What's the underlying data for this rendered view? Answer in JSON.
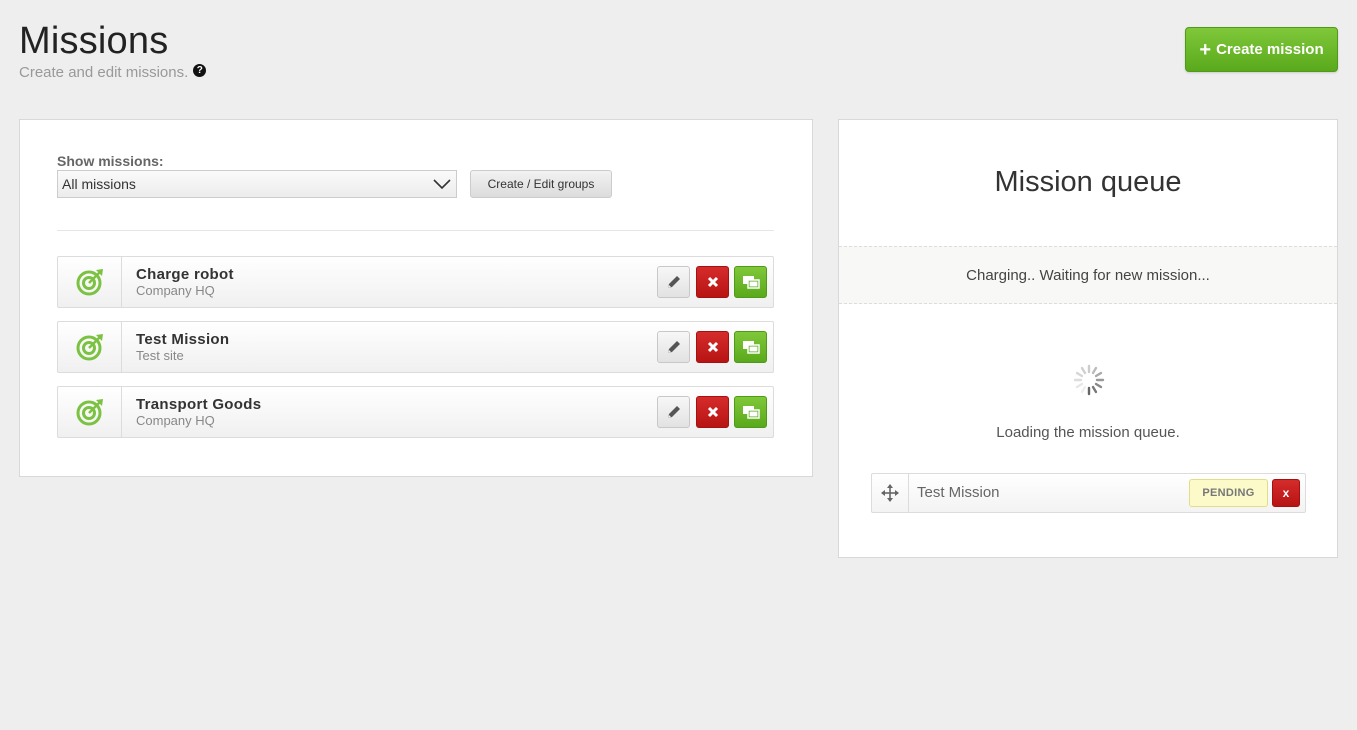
{
  "header": {
    "title": "Missions",
    "subtitle": "Create and edit missions.",
    "help_icon": "question-circle-icon",
    "create_button": {
      "icon": "plus-icon",
      "label": "Create mission"
    }
  },
  "colors": {
    "accent_green": "#6bb82a",
    "danger_red": "#c41f1f",
    "pending_yellow": "#fbfac8",
    "background": "#eeeeee"
  },
  "missions_panel": {
    "filter_label": "Show missions:",
    "filter_value": "All missions",
    "groups_button": "Create / Edit groups",
    "missions": [
      {
        "name": "Charge robot",
        "site": "Company HQ",
        "icon": "target-icon"
      },
      {
        "name": "Test Mission",
        "site": "Test site",
        "icon": "target-icon"
      },
      {
        "name": "Transport Goods",
        "site": "Company HQ",
        "icon": "target-icon"
      }
    ],
    "row_actions": [
      "pencil-icon",
      "close-icon",
      "duplicate-icon"
    ]
  },
  "queue_panel": {
    "title": "Mission queue",
    "status": "Charging.. Waiting for new mission...",
    "loading_text": "Loading the mission queue.",
    "items": [
      {
        "name": "Test Mission",
        "state": "PENDING",
        "remove_label": "x",
        "drag_icon": "move-icon"
      }
    ]
  }
}
